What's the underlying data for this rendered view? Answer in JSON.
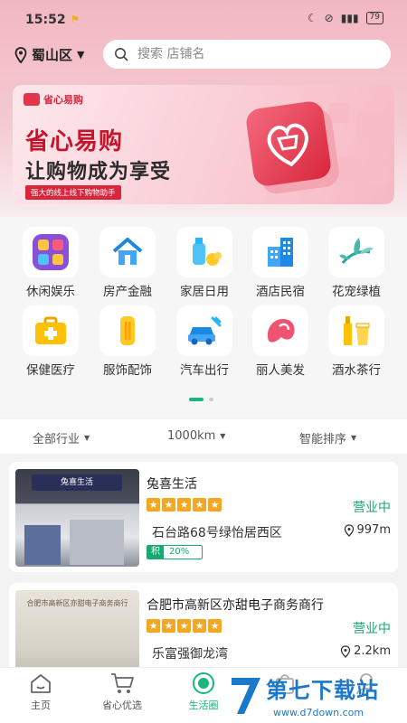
{
  "status_bar": {
    "time": "15:52",
    "battery": "79"
  },
  "header": {
    "location": "蜀山区",
    "search_placeholder": "搜索 店铺名"
  },
  "banner": {
    "logo_text": "省心易购",
    "title_line1": "省心易购",
    "title_line2": "让购物成为享受",
    "tagline": "强大的线上线下购物助手"
  },
  "categories": [
    {
      "label": "休闲娱乐",
      "icon": "entertainment-icon"
    },
    {
      "label": "房产金融",
      "icon": "house-icon"
    },
    {
      "label": "家居日用",
      "icon": "household-icon"
    },
    {
      "label": "酒店民宿",
      "icon": "hotel-icon"
    },
    {
      "label": "花宠绿植",
      "icon": "plant-icon"
    },
    {
      "label": "保健医疗",
      "icon": "medical-kit-icon"
    },
    {
      "label": "服饰配饰",
      "icon": "clothing-icon"
    },
    {
      "label": "汽车出行",
      "icon": "car-icon"
    },
    {
      "label": "丽人美发",
      "icon": "beauty-icon"
    },
    {
      "label": "酒水茶行",
      "icon": "drinks-icon"
    }
  ],
  "filters": {
    "industry": "全部行业",
    "distance": "1000km",
    "sort": "智能排序"
  },
  "stores": [
    {
      "name": "兔喜生活",
      "status": "营业中",
      "address": "石台路68号绿怡居西区",
      "distance": "997m",
      "points_tag": "积",
      "points_value": "20%",
      "rating": 5,
      "photo_sign": "兔喜生活"
    },
    {
      "name": "合肥市高新区亦甜电子商务商行",
      "status": "营业中",
      "address": "乐富强御龙湾",
      "distance": "2.2km",
      "rating": 5,
      "photo_sign": "合肥市高新区亦甜电子商务商行"
    }
  ],
  "bottom_nav": [
    {
      "label": "主页",
      "icon": "home-icon",
      "active": false
    },
    {
      "label": "省心优选",
      "icon": "cart-icon",
      "active": false
    },
    {
      "label": "生活圈",
      "icon": "life-circle-icon",
      "active": true
    },
    {
      "label": "",
      "icon": "bag-icon",
      "active": false
    },
    {
      "label": "",
      "icon": "profile-icon",
      "active": false
    }
  ],
  "watermark": {
    "title": "第七下载站",
    "url": "www.d7down.com"
  },
  "colors": {
    "accent": "#18b77b",
    "brand_red": "#d8263c",
    "star": "#f5a623"
  }
}
